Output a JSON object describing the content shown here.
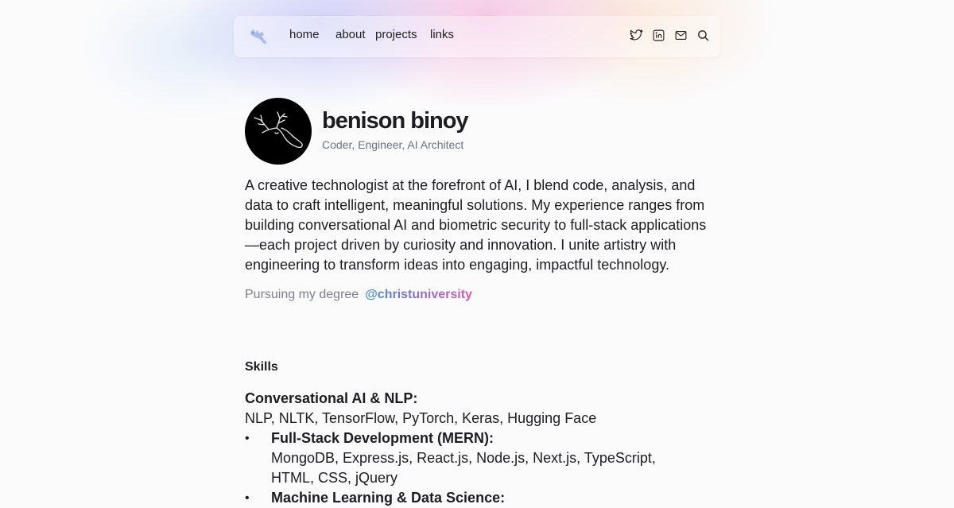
{
  "nav": {
    "links": [
      "home",
      "about",
      "projects",
      "links"
    ],
    "icons": [
      "logo-icon",
      "twitter-icon",
      "linkedin-icon",
      "mail-icon",
      "search-icon"
    ]
  },
  "profile": {
    "name": "benison binoy",
    "tagline": "Coder, Engineer, AI Architect",
    "bio": "A creative technologist at the forefront of AI, I blend code, analysis, and data to craft intelligent, meaningful solutions. My experience ranges from building conversational AI and biometric security to full-stack applications—each project driven by curiosity and innovation. I unite artistry with engineering to transform ideas into engaging, impactful technology.",
    "pursuing_label": "Pursuing my degree",
    "university": "@christuniversity"
  },
  "skills": {
    "heading": "Skills",
    "items": [
      {
        "title": "Conversational AI & NLP:",
        "detail": "NLP, NLTK, TensorFlow, PyTorch, Keras, Hugging Face",
        "bullet": ""
      },
      {
        "title": "Full-Stack Development (MERN):",
        "detail": "MongoDB, Express.js, React.js, Node.js, Next.js, TypeScript, HTML, CSS, jQuery",
        "bullet": "•"
      },
      {
        "title": "Machine Learning & Data Science:",
        "detail": "",
        "bullet": "•"
      }
    ]
  },
  "colors": {
    "accent_start": "#3d8fe0",
    "accent_end": "#d85aa6",
    "text": "#1c1c22",
    "muted": "#6c7082"
  }
}
